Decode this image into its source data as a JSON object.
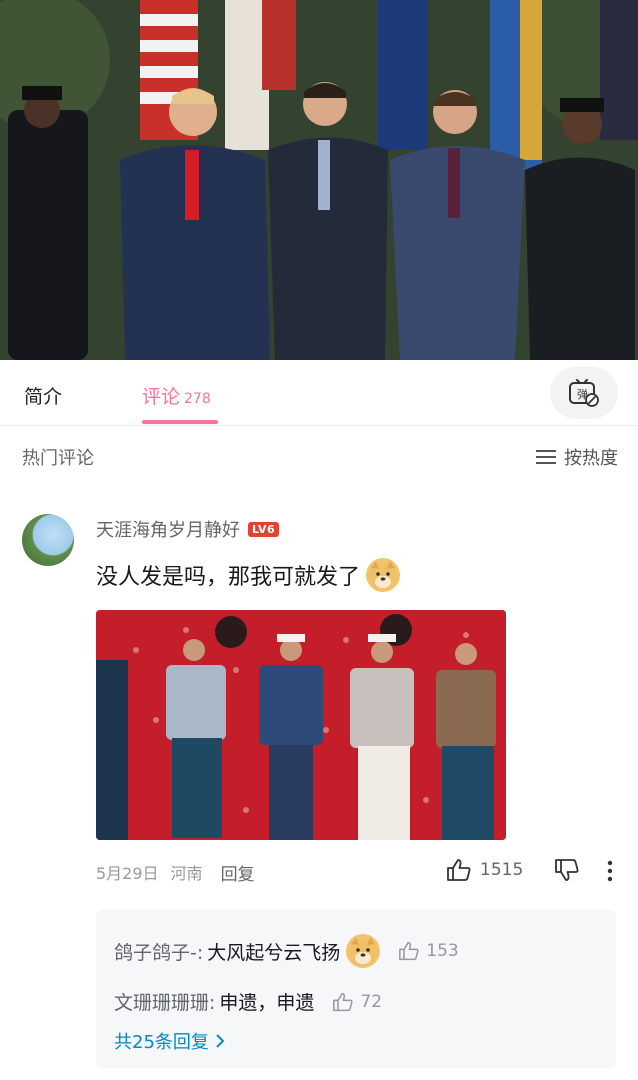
{
  "tabs": {
    "intro": "简介",
    "comments": "评论",
    "comments_count": "278",
    "danmaku_icon": "danmaku-off-icon",
    "danmaku_glyph": "弹"
  },
  "sort": {
    "hot_title": "热门评论",
    "sort_label": "按热度"
  },
  "comment": {
    "username": "天涯海角岁月静好",
    "level": "LV6",
    "text": "没人发是吗，那我可就发了",
    "date": "5月29日",
    "location": "河南",
    "reply_label": "回复",
    "likes": "1515"
  },
  "replies": [
    {
      "name": "鸽子鸽子-:",
      "text": "大风起兮云飞扬",
      "likes": "153",
      "has_emoji": true
    },
    {
      "name": "文珊珊珊珊:",
      "text": "申遗，申遗",
      "likes": "72",
      "has_emoji": false
    }
  ],
  "total_replies": "共25条回复",
  "colors": {
    "accent": "#fb7299",
    "link": "#008ac5",
    "level_badge": "#e2432e"
  }
}
